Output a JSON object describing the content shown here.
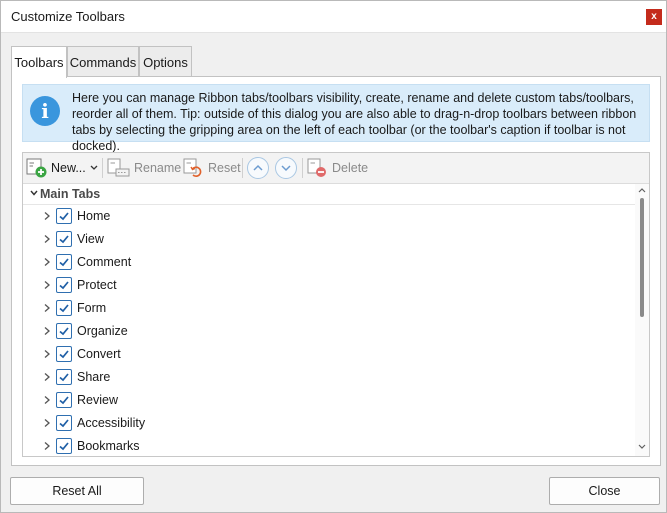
{
  "window": {
    "title": "Customize Toolbars",
    "close_glyph": "x"
  },
  "tabs": [
    {
      "label": "Toolbars",
      "active": true
    },
    {
      "label": "Commands",
      "active": false
    },
    {
      "label": "Options",
      "active": false
    }
  ],
  "info": {
    "icon": "info-icon",
    "text": "Here you can manage Ribbon tabs/toolbars visibility, create, rename and delete custom tabs/toolbars, reorder all of them. Tip: outside of this dialog you are also able to drag-n-drop toolbars between ribbon tabs by selecting the gripping area on the left of each toolbar (or the toolbar's caption if toolbar is not docked)."
  },
  "toolbar": {
    "new_label": "New...",
    "rename_label": "Rename",
    "reset_label": "Reset",
    "delete_label": "Delete"
  },
  "tree": {
    "group_label": "Main Tabs",
    "items": [
      {
        "label": "Home",
        "checked": true
      },
      {
        "label": "View",
        "checked": true
      },
      {
        "label": "Comment",
        "checked": true
      },
      {
        "label": "Protect",
        "checked": true
      },
      {
        "label": "Form",
        "checked": true
      },
      {
        "label": "Organize",
        "checked": true
      },
      {
        "label": "Convert",
        "checked": true
      },
      {
        "label": "Share",
        "checked": true
      },
      {
        "label": "Review",
        "checked": true
      },
      {
        "label": "Accessibility",
        "checked": true
      },
      {
        "label": "Bookmarks",
        "checked": true
      }
    ]
  },
  "footer": {
    "reset_all_label": "Reset All",
    "close_label": "Close"
  },
  "colors": {
    "accent": "#3a96dd",
    "close_red": "#c42b1c",
    "check": "#1f5fa6"
  }
}
